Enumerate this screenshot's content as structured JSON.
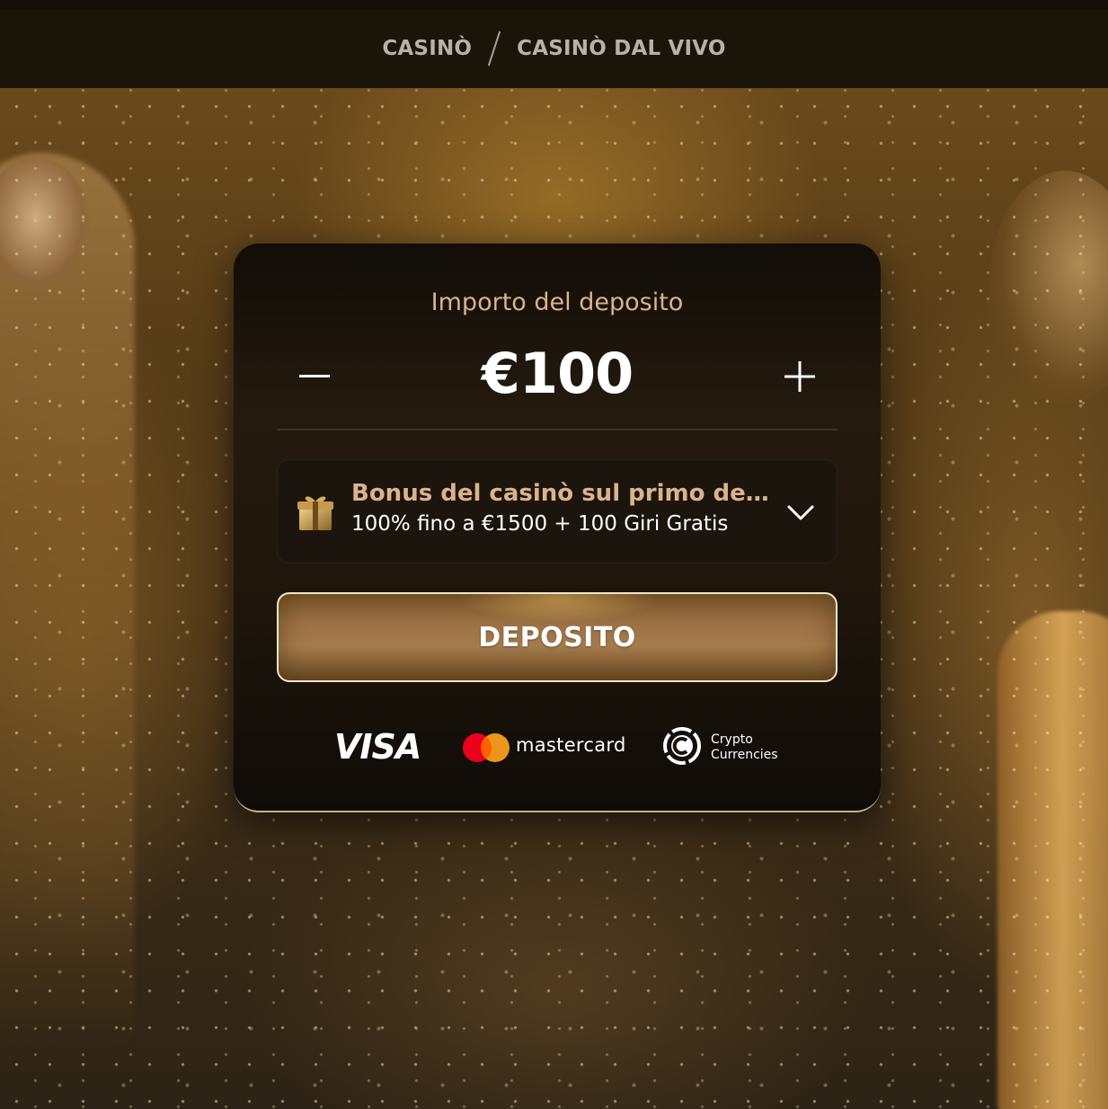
{
  "nav": {
    "casino": "CASINÒ",
    "live_casino": "CASINÒ DAL VIVO"
  },
  "deposit": {
    "amount_label": "Importo del deposito",
    "amount_value": "€100",
    "decrease_icon": "minus-icon",
    "increase_icon": "plus-icon"
  },
  "bonus": {
    "icon": "gift-icon",
    "title": "Bonus del casinò sul primo dep...",
    "description": "100% fino a €1500 + 100 Giri Gratis",
    "toggle_icon": "chevron-down-icon"
  },
  "deposit_button": {
    "label": "DEPOSITO"
  },
  "payments": {
    "visa": "VISA",
    "mastercard": "mastercard",
    "crypto_line1": "Crypto",
    "crypto_line2": "Currencies"
  },
  "colors": {
    "accent_gold": "#d9b48c",
    "nav_text": "#b9b1a3",
    "button_border": "#f3e6c8",
    "mastercard_red": "#eb001b",
    "mastercard_orange": "#f79e1b"
  }
}
